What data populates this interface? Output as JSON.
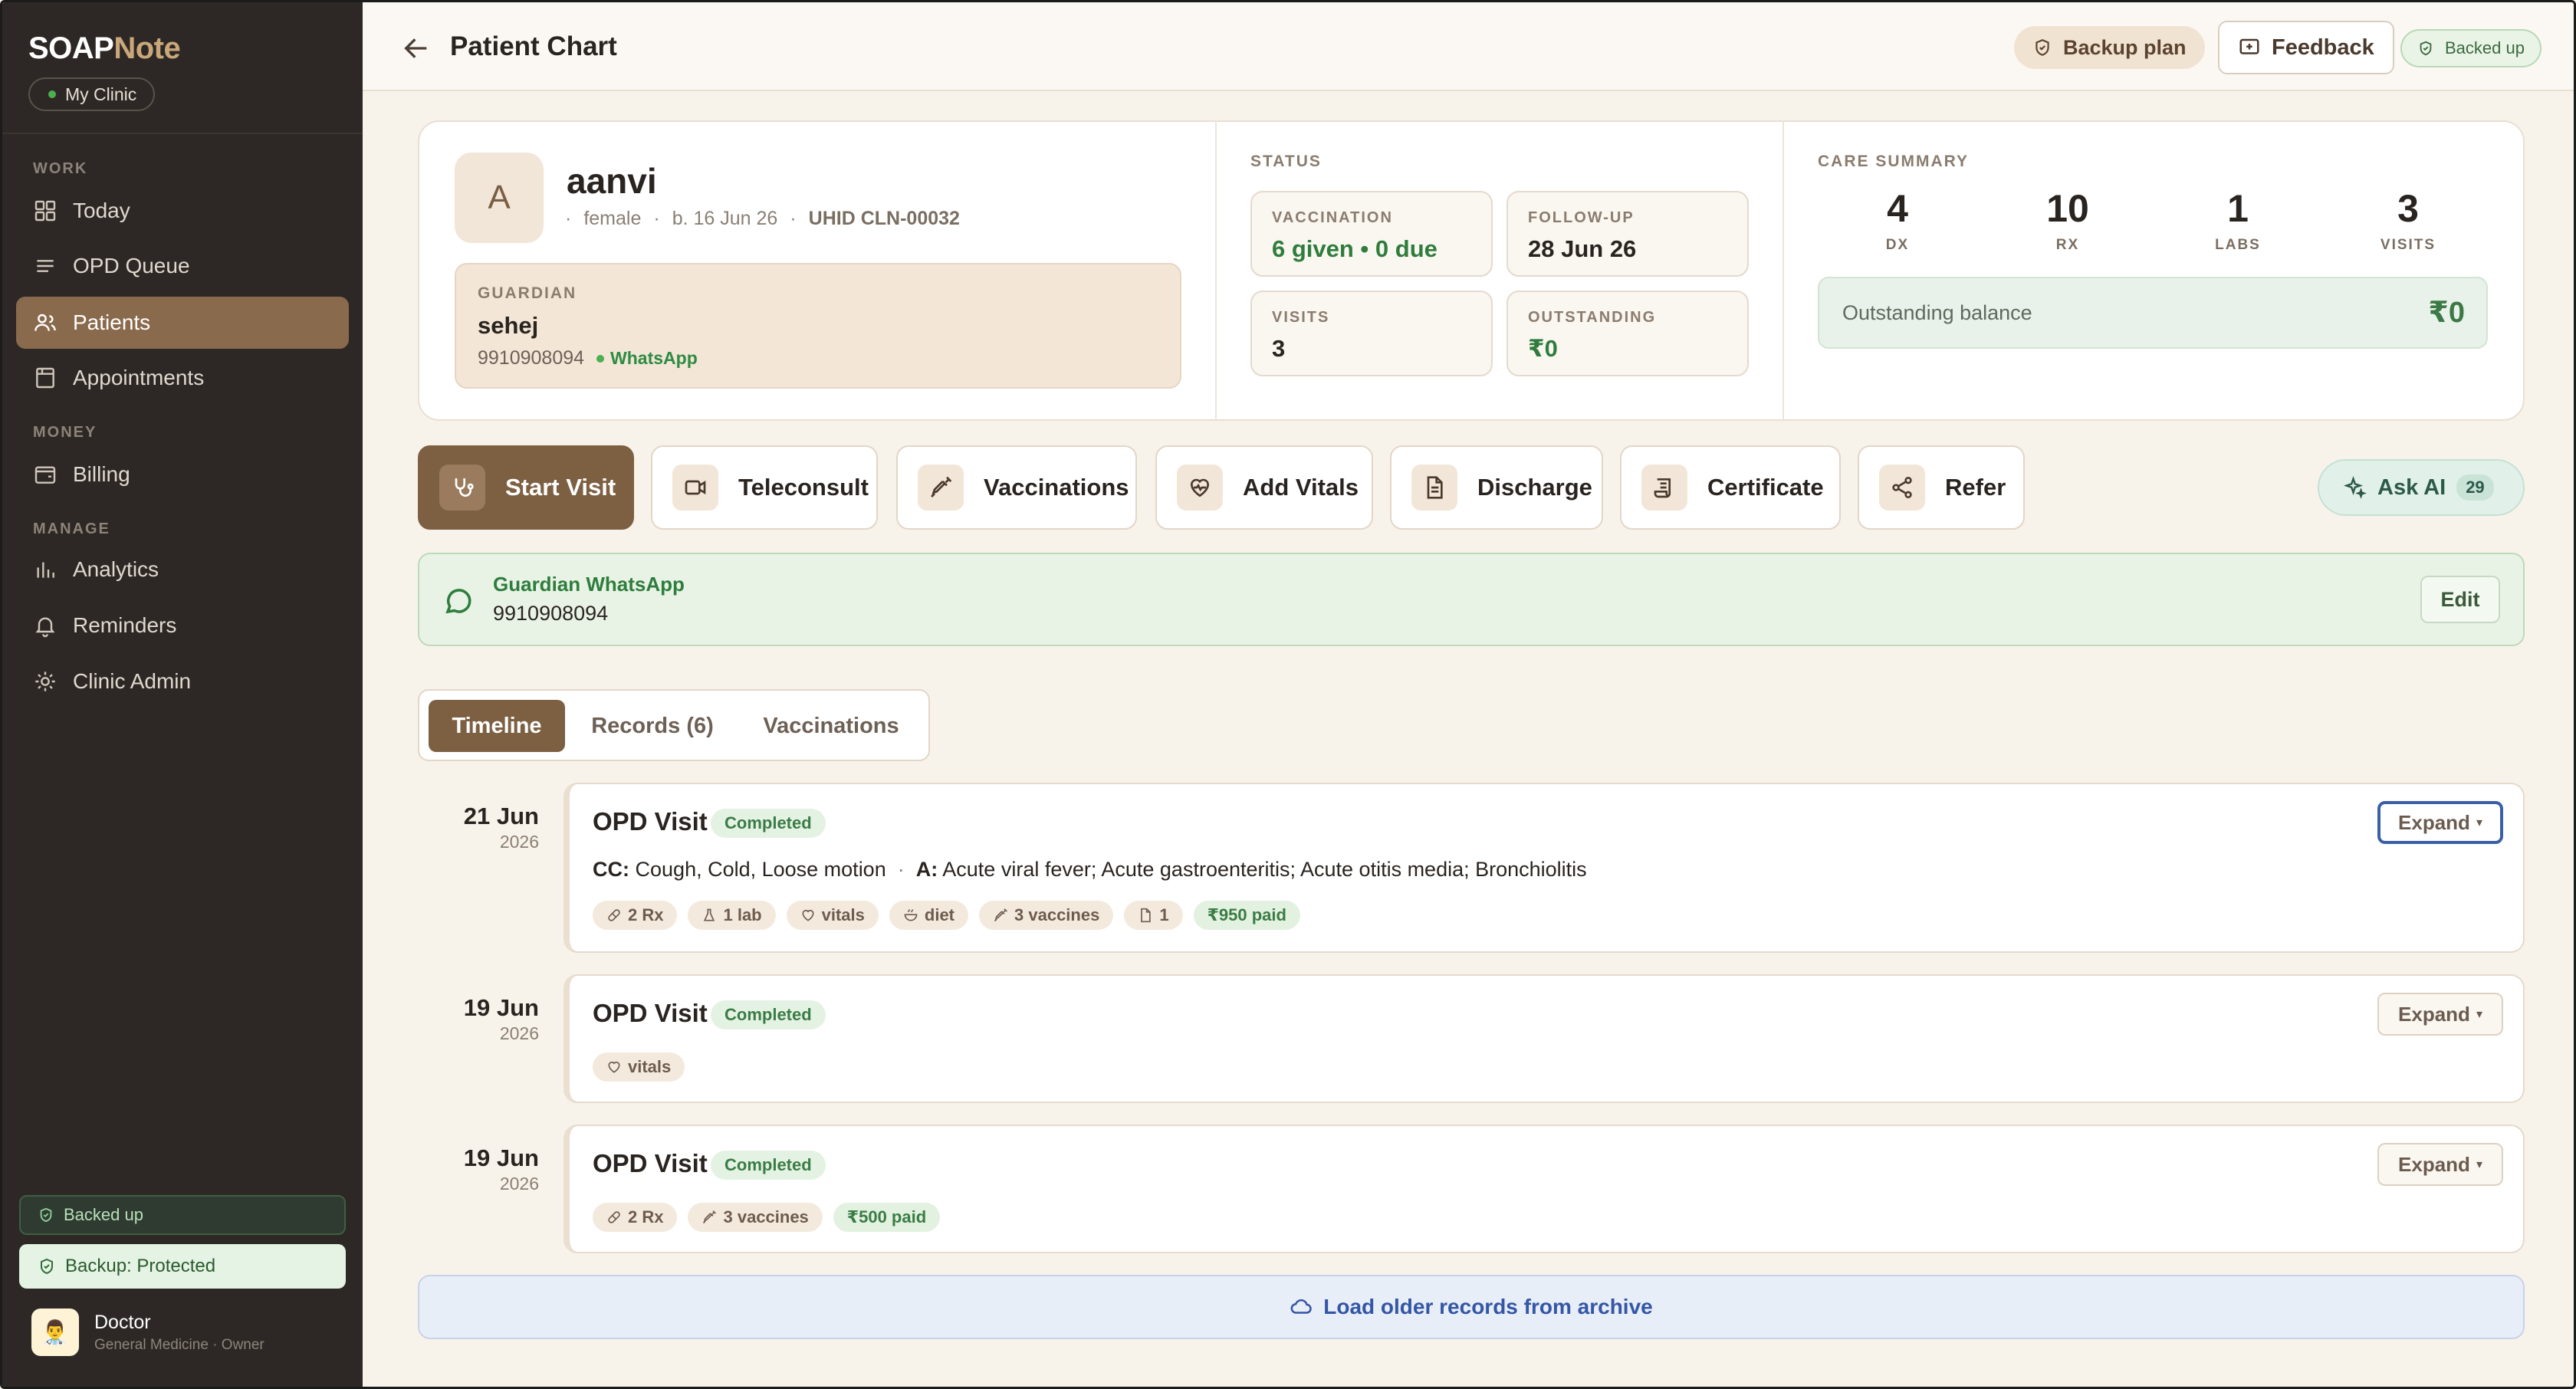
{
  "sidebar": {
    "brand_a": "SOAP",
    "brand_b": "Note",
    "clinic": "My Clinic",
    "sections": {
      "work": "WORK",
      "money": "MONEY",
      "manage": "MANAGE"
    },
    "items": [
      {
        "label": "Today",
        "icon": "grid-icon"
      },
      {
        "label": "OPD Queue",
        "icon": "list-icon"
      },
      {
        "label": "Patients",
        "icon": "users-icon",
        "active": true
      },
      {
        "label": "Appointments",
        "icon": "calendar-icon"
      },
      {
        "label": "Billing",
        "icon": "wallet-icon"
      },
      {
        "label": "Analytics",
        "icon": "bar-chart-icon"
      },
      {
        "label": "Reminders",
        "icon": "bell-icon"
      },
      {
        "label": "Clinic Admin",
        "icon": "sun-gear-icon"
      }
    ],
    "backed_up": "Backed up",
    "backup_protected": "Backup: Protected",
    "doctor": {
      "name": "Doctor",
      "subtitle": "General Medicine · Owner"
    }
  },
  "header": {
    "title": "Patient Chart",
    "backup_plan": "Backup plan",
    "feedback": "Feedback",
    "backed_up": "Backed up"
  },
  "patient": {
    "initial": "A",
    "name": "aanvi",
    "gender": "female",
    "dob": "b. 16 Jun 26",
    "uhid": "UHID CLN-00032",
    "guardian_label": "GUARDIAN",
    "guardian_name": "sehej",
    "guardian_phone": "9910908094",
    "whatsapp": "WhatsApp"
  },
  "status": {
    "label": "STATUS",
    "vaccination_label": "VACCINATION",
    "vaccination_value": "6 given • 0 due",
    "followup_label": "FOLLOW-UP",
    "followup_value": "28 Jun 26",
    "visits_label": "VISITS",
    "visits_value": "3",
    "outstanding_label": "OUTSTANDING",
    "outstanding_value": "₹0"
  },
  "care_summary": {
    "label": "CARE SUMMARY",
    "dx": "4",
    "dx_label": "DX",
    "rx": "10",
    "rx_label": "RX",
    "labs": "1",
    "labs_label": "LABS",
    "visits": "3",
    "visits_label": "VISITS",
    "balance_label": "Outstanding balance",
    "balance_value": "₹0"
  },
  "actions": {
    "start_visit": "Start Visit",
    "teleconsult": "Teleconsult",
    "vaccinations": "Vaccinations",
    "add_vitals": "Add Vitals",
    "discharge": "Discharge",
    "certificate": "Certificate",
    "refer": "Refer",
    "ask_ai": "Ask AI",
    "ask_ai_count": "29"
  },
  "whatsapp_banner": {
    "title": "Guardian WhatsApp",
    "phone": "9910908094",
    "edit": "Edit"
  },
  "tabs": {
    "timeline": "Timeline",
    "records": "Records (6)",
    "vaccinations": "Vaccinations"
  },
  "timeline": [
    {
      "date": "21 Jun",
      "year": "2026",
      "title": "OPD Visit",
      "status": "Completed",
      "expand": "Expand",
      "cc_label": "CC:",
      "cc": "Cough, Cold, Loose motion",
      "sep": "·",
      "a_label": "A:",
      "a": "Acute viral fever; Acute gastroenteritis; Acute otitis media; Bronchiolitis",
      "tags": [
        "2 Rx",
        "1 lab",
        "vitals",
        "diet",
        "3 vaccines",
        "1",
        "₹950 paid"
      ]
    },
    {
      "date": "19 Jun",
      "year": "2026",
      "title": "OPD Visit",
      "status": "Completed",
      "expand": "Expand",
      "tags": [
        "vitals"
      ]
    },
    {
      "date": "19 Jun",
      "year": "2026",
      "title": "OPD Visit",
      "status": "Completed",
      "expand": "Expand",
      "tags": [
        "2 Rx",
        "3 vaccines",
        "₹500 paid"
      ]
    }
  ],
  "archive": "Load older records from archive"
}
